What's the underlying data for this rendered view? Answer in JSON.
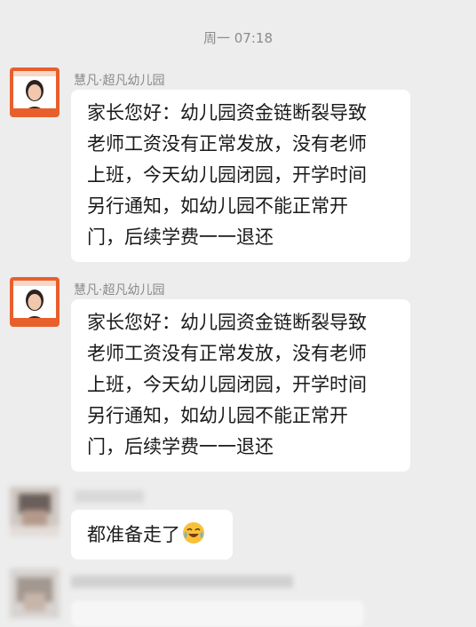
{
  "timestamp": "周一 07:18",
  "colors": {
    "background": "#ededed",
    "bubble": "#ffffff",
    "avatar_bg": "#e85f2c"
  },
  "messages": [
    {
      "sender": "慧凡·超凡幼儿园",
      "avatar_icon": "kindergarten-teacher-avatar",
      "lines": [
        "家长您好：幼儿园资金链断裂导致",
        "老师工资没有正常发放，没有老师",
        "上班，今天幼儿园闭园，开学时间",
        "另行通知，如幼儿园不能正常开",
        "门，后续学费一一退还"
      ]
    },
    {
      "sender": "慧凡·超凡幼儿园",
      "avatar_icon": "kindergarten-teacher-avatar",
      "lines": [
        "家长您好：幼儿园资金链断裂导致",
        "老师工资没有正常发放，没有老师",
        "上班，今天幼儿园闭园，开学时间",
        "另行通知，如幼儿园不能正常开",
        "门，后续学费一一退还"
      ]
    },
    {
      "sender": "",
      "avatar_icon": "blurred-avatar",
      "text": "都准备走了",
      "emoji": "crying-laughing-emoji"
    }
  ]
}
